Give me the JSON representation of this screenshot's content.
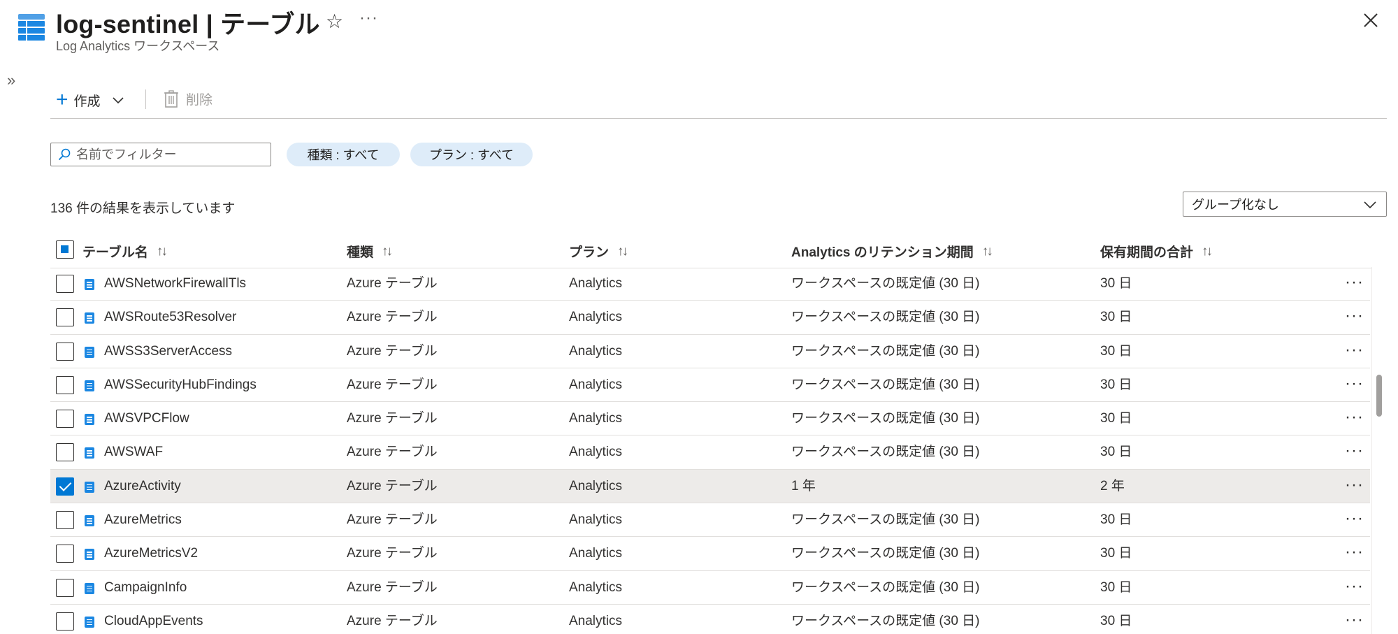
{
  "header": {
    "title": "log-sentinel | テーブル",
    "subtitle": "Log Analytics ワークスペース",
    "star_icon": "☆",
    "more_icon": "···",
    "expand_icon": "»"
  },
  "toolbar": {
    "create_label": "作成",
    "plus_icon": "+",
    "delete_label": "削除"
  },
  "filters": {
    "search_placeholder": "名前でフィルター",
    "type_pill": "種類 : すべて",
    "plan_pill": "プラン : すべて"
  },
  "results": {
    "count_text": "136 件の結果を表示しています",
    "group_by": "グループ化なし"
  },
  "table": {
    "sort_icon": "↑↓",
    "columns": [
      "テーブル名",
      "種類",
      "プラン",
      "Analytics のリテンション期間",
      "保有期間の合計"
    ],
    "row_more_icon": "···",
    "rows": [
      {
        "name": "AWSNetworkFirewallTls",
        "type": "Azure テーブル",
        "plan": "Analytics",
        "retention": "ワークスペースの既定値 (30 日)",
        "total": "30 日",
        "checked": false
      },
      {
        "name": "AWSRoute53Resolver",
        "type": "Azure テーブル",
        "plan": "Analytics",
        "retention": "ワークスペースの既定値 (30 日)",
        "total": "30 日",
        "checked": false
      },
      {
        "name": "AWSS3ServerAccess",
        "type": "Azure テーブル",
        "plan": "Analytics",
        "retention": "ワークスペースの既定値 (30 日)",
        "total": "30 日",
        "checked": false
      },
      {
        "name": "AWSSecurityHubFindings",
        "type": "Azure テーブル",
        "plan": "Analytics",
        "retention": "ワークスペースの既定値 (30 日)",
        "total": "30 日",
        "checked": false
      },
      {
        "name": "AWSVPCFlow",
        "type": "Azure テーブル",
        "plan": "Analytics",
        "retention": "ワークスペースの既定値 (30 日)",
        "total": "30 日",
        "checked": false
      },
      {
        "name": "AWSWAF",
        "type": "Azure テーブル",
        "plan": "Analytics",
        "retention": "ワークスペースの既定値 (30 日)",
        "total": "30 日",
        "checked": false
      },
      {
        "name": "AzureActivity",
        "type": "Azure テーブル",
        "plan": "Analytics",
        "retention": "1 年",
        "total": "2 年",
        "checked": true
      },
      {
        "name": "AzureMetrics",
        "type": "Azure テーブル",
        "plan": "Analytics",
        "retention": "ワークスペースの既定値 (30 日)",
        "total": "30 日",
        "checked": false
      },
      {
        "name": "AzureMetricsV2",
        "type": "Azure テーブル",
        "plan": "Analytics",
        "retention": "ワークスペースの既定値 (30 日)",
        "total": "30 日",
        "checked": false
      },
      {
        "name": "CampaignInfo",
        "type": "Azure テーブル",
        "plan": "Analytics",
        "retention": "ワークスペースの既定値 (30 日)",
        "total": "30 日",
        "checked": false
      },
      {
        "name": "CloudAppEvents",
        "type": "Azure テーブル",
        "plan": "Analytics",
        "retention": "ワークスペースの既定値 (30 日)",
        "total": "30 日",
        "checked": false
      }
    ]
  },
  "colors": {
    "accent": "#0078d4",
    "pill_bg": "#deecf9",
    "selected_row": "#edebe9"
  }
}
